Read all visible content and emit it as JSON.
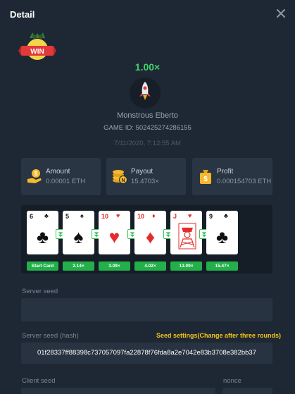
{
  "header": {
    "title": "Detail"
  },
  "badge": {
    "label": "WIN"
  },
  "result": {
    "multiplier": "1.00×",
    "player_name": "Monstrous Eberto",
    "game_id_label": "GAME ID:",
    "game_id": "502425274286155",
    "timestamp": "7/11/2020, 7:12:55 AM"
  },
  "stats": [
    {
      "label": "Amount",
      "value": "0.00001 ETH",
      "icon": "coin-hand-icon"
    },
    {
      "label": "Payout",
      "value": "15.4703×",
      "icon": "coins-stack-icon"
    },
    {
      "label": "Profit",
      "value": "0.000154703 ETH",
      "icon": "money-bag-icon"
    }
  ],
  "cards": [
    {
      "rank": "6",
      "suit": "♣",
      "color": "black"
    },
    {
      "rank": "5",
      "suit": "♠",
      "color": "black"
    },
    {
      "rank": "10",
      "suit": "♥",
      "color": "red"
    },
    {
      "rank": "10",
      "suit": "♦",
      "color": "red"
    },
    {
      "rank": "J",
      "suit": "♥",
      "color": "red"
    },
    {
      "rank": "9",
      "suit": "♣",
      "color": "black"
    }
  ],
  "multipliers": [
    "Start Card",
    "2.14×",
    "3.09×",
    "4.02×",
    "13.09×",
    "15.47×"
  ],
  "server_seed": {
    "label": "Server seed",
    "value": ""
  },
  "server_seed_hash": {
    "label": "Server seed (hash)",
    "value": "01f28337ff88398c737057097fa22878f76fda8a2e7042e83b3708e382bb37",
    "settings_link": "Seed settings(Change after three rounds)"
  },
  "client_seed": {
    "label": "Client seed",
    "value": ""
  },
  "nonce": {
    "label": "nonce",
    "value": ""
  },
  "colors": {
    "accent_green": "#23b04a",
    "multiplier_green": "#3ed36b",
    "link_yellow": "#f5c518",
    "background": "#1e2834",
    "panel": "#2a3544"
  }
}
